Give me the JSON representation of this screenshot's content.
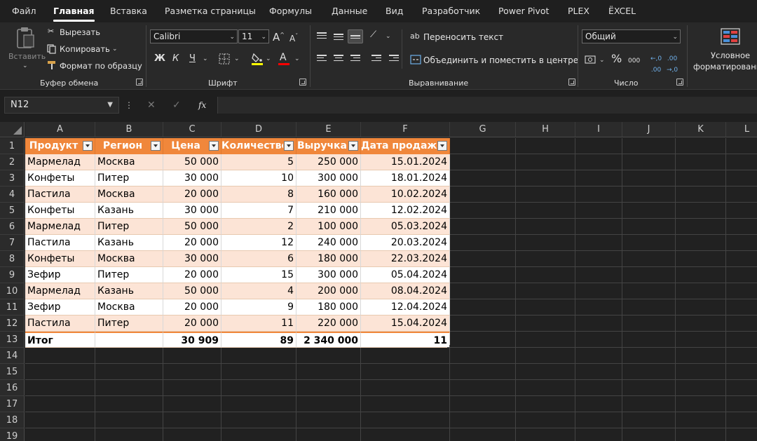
{
  "menu": {
    "tabs": [
      "Файл",
      "Главная",
      "Вставка",
      "Разметка страницы",
      "Формулы",
      "Данные",
      "Вид",
      "Разработчик",
      "Power Pivot",
      "PLEX",
      "ЁXCEL"
    ],
    "active": "Главная"
  },
  "ribbon": {
    "clipboard": {
      "paste_label": "Вставить",
      "cut_label": "Вырезать",
      "copy_label": "Копировать",
      "format_painter_label": "Формат по образцу",
      "group_label": "Буфер обмена"
    },
    "font": {
      "font_name": "Calibri",
      "font_size": "11",
      "grow_label": "A",
      "shrink_label": "A",
      "bold_label": "Ж",
      "italic_label": "К",
      "underline_label": "Ч",
      "font_color_label": "A",
      "group_label": "Шрифт",
      "highlight_color": "#ffff00",
      "font_color": "#ff0000"
    },
    "alignment": {
      "wrap_text_label": "Переносить текст",
      "merge_center_label": "Объединить и поместить в центре",
      "group_label": "Выравнивание"
    },
    "number": {
      "format": "Общий",
      "percent_label": "%",
      "thousands_label": "000",
      "group_label": "Число"
    },
    "styles": {
      "conditional_line1": "Условное",
      "conditional_line2": "форматирование"
    }
  },
  "formula_bar": {
    "name_box": "N12",
    "fx_label": "fx",
    "formula": ""
  },
  "sheet": {
    "columns": [
      "A",
      "B",
      "C",
      "D",
      "E",
      "F",
      "G",
      "H",
      "I",
      "J",
      "K",
      "L"
    ],
    "rows": [
      "1",
      "2",
      "3",
      "4",
      "5",
      "6",
      "7",
      "8",
      "9",
      "10",
      "11",
      "12",
      "13",
      "14",
      "15",
      "16",
      "17",
      "18",
      "19"
    ],
    "table": {
      "headers": [
        "Продукт",
        "Регион",
        "Цена",
        "Количество",
        "Выручка",
        "Дата продажи"
      ],
      "header_color": "#f0873b",
      "band_color": "#fce4d6",
      "rows": [
        [
          "Мармелад",
          "Москва",
          "50 000",
          "5",
          "250 000",
          "15.01.2024"
        ],
        [
          "Конфеты",
          "Питер",
          "30 000",
          "10",
          "300 000",
          "18.01.2024"
        ],
        [
          "Пастила",
          "Москва",
          "20 000",
          "8",
          "160 000",
          "10.02.2024"
        ],
        [
          "Конфеты",
          "Казань",
          "30 000",
          "7",
          "210 000",
          "12.02.2024"
        ],
        [
          "Мармелад",
          "Питер",
          "50 000",
          "2",
          "100 000",
          "05.03.2024"
        ],
        [
          "Пастила",
          "Казань",
          "20 000",
          "12",
          "240 000",
          "20.03.2024"
        ],
        [
          "Конфеты",
          "Москва",
          "30 000",
          "6",
          "180 000",
          "22.03.2024"
        ],
        [
          "Зефир",
          "Питер",
          "20 000",
          "15",
          "300 000",
          "05.04.2024"
        ],
        [
          "Мармелад",
          "Казань",
          "50 000",
          "4",
          "200 000",
          "08.04.2024"
        ],
        [
          "Зефир",
          "Москва",
          "20 000",
          "9",
          "180 000",
          "12.04.2024"
        ],
        [
          "Пастила",
          "Питер",
          "20 000",
          "11",
          "220 000",
          "15.04.2024"
        ]
      ],
      "total": [
        "Итог",
        "",
        "30 909",
        "89",
        "2 340 000",
        "11"
      ]
    }
  }
}
